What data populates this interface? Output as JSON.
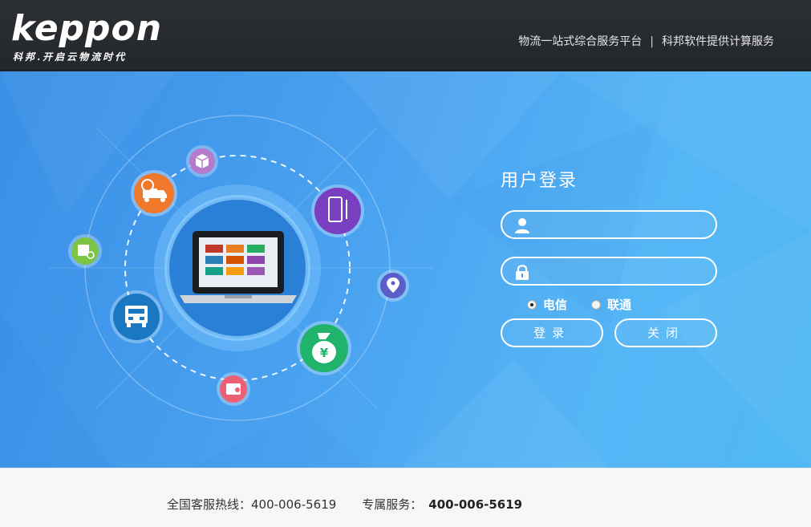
{
  "header": {
    "logo_text": "keppon",
    "logo_slogan": "科邦.开启云物流时代",
    "tagline_left": "物流一站式综合服务平台",
    "tagline_sep": "|",
    "tagline_right": "科邦软件提供计算服务"
  },
  "login": {
    "title": "用户登录",
    "username_value": "",
    "password_value": "",
    "network_options": [
      {
        "label": "电信",
        "selected": true
      },
      {
        "label": "联通",
        "selected": false
      }
    ],
    "login_button": "登录",
    "close_button": "关闭"
  },
  "footer": {
    "hotline_label": "全国客服热线：",
    "hotline_number": "400-006-5619",
    "exclusive_label": "专属服务：",
    "exclusive_number": "400-006-5619"
  },
  "colors": {
    "header_bg": "#272a2d",
    "main_gradient_start": "#3a8fe6",
    "main_gradient_end": "#4fb8f3",
    "footer_bg": "#f7f7f7",
    "orange_icon": "#f0782a",
    "purple_icon": "#7a3fc0",
    "green_icon": "#1fb36b",
    "truck_icon": "#1a78c2",
    "lime_icon": "#7cc544",
    "pink_icon": "#ef5f73",
    "violet_small_icon": "#b57acb",
    "pin_icon": "#5a5fc8"
  },
  "icons": [
    "user-icon",
    "lock-icon",
    "truck-clock-icon",
    "package-icon",
    "phone-icon",
    "location-pin-icon",
    "money-bag-icon",
    "wallet-icon",
    "delivery-truck-icon",
    "delivery-tag-icon",
    "laptop-icon"
  ]
}
